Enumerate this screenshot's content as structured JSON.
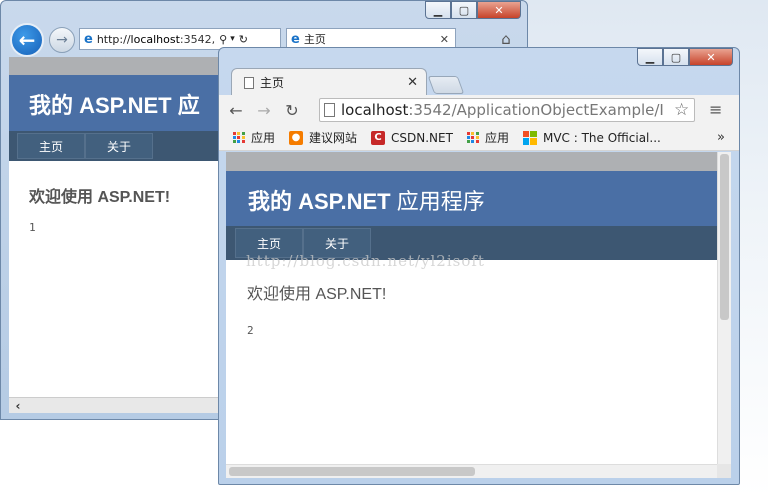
{
  "ie": {
    "url_prefix": "http://",
    "url_host": "localhost",
    "url_rest": ":3542,",
    "tab_title": "主页",
    "header_title": "我的 ASP.NET 应",
    "nav": [
      "主页",
      "关于"
    ],
    "welcome": "欢迎使用 ASP.NET!",
    "counter": "1"
  },
  "chrome": {
    "tab_title": "主页",
    "omnibox_host": "localhost",
    "omnibox_path": ":3542/ApplicationObjectExample/I",
    "bookmarks": [
      {
        "label": "应用",
        "icon": "apps-icon"
      },
      {
        "label": "建议网站",
        "icon": "suggested-sites-icon"
      },
      {
        "label": "CSDN.NET",
        "icon": "csdn-icon"
      },
      {
        "label": "应用",
        "icon": "apps-icon"
      },
      {
        "label": "MVC : The Official...",
        "icon": "microsoft-icon"
      }
    ],
    "header_title_bold": "我的 ASP.NET",
    "header_title_rest": " 应用程序",
    "nav": [
      "主页",
      "关于"
    ],
    "watermark": "http://blog.csdn.net/yl2isoft",
    "welcome": "欢迎使用 ASP.NET!",
    "counter": "2"
  },
  "colors": {
    "header_bg": "#4a6fa5",
    "nav_bg": "#3d5772"
  }
}
